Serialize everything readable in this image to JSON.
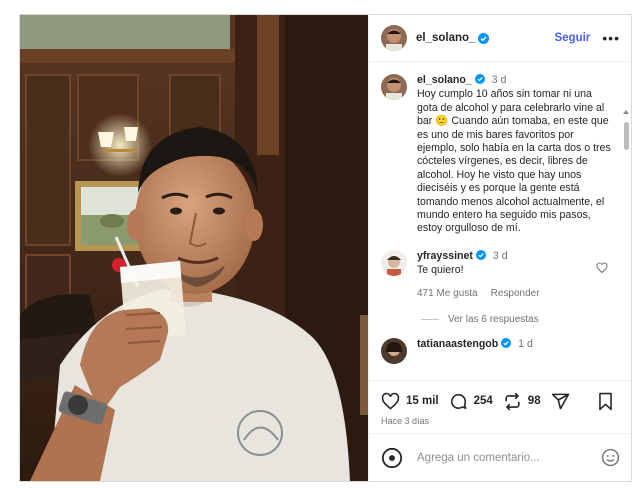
{
  "header": {
    "username": "el_solano_",
    "follow_label": "Seguir",
    "more_label": "•••"
  },
  "caption": {
    "username": "el_solano_",
    "time": "3 d",
    "text": "Hoy cumplo 10 años sin tomar ni una gota de alcohol y para celebrarlo vine al bar 🙂 Cuando aún tomaba, en este que es uno de mis bares favoritos por ejemplo, solo había en la carta dos o tres cócteles vírgenes, es decir, libres de alcohol. Hoy he visto que hay unos dieciséis y es porque la gente está tomando menos alcohol actualmente, el mundo entero ha seguido mis pasos, estoy orgulloso de mí."
  },
  "comments": [
    {
      "username": "yfrayssinet",
      "time": "3 d",
      "text": "Te quiero!",
      "likes": "471 Me gusta",
      "reply_label": "Responder",
      "view_replies": "Ver las 6 respuestas"
    },
    {
      "username": "tatianaastengob",
      "time": "1 d"
    }
  ],
  "actions": {
    "likes": "15 mil",
    "comments": "254",
    "reposts": "98",
    "time_ago": "Hace 3 días"
  },
  "composer": {
    "placeholder": "Agrega un comentario..."
  },
  "icons": [
    "verified-badge-icon",
    "heart-icon",
    "comment-icon",
    "repost-icon",
    "share-icon",
    "bookmark-icon",
    "emoji-icon",
    "more-icon"
  ],
  "colors": {
    "accent": "#4a5df9",
    "verified": "#0095f6"
  }
}
